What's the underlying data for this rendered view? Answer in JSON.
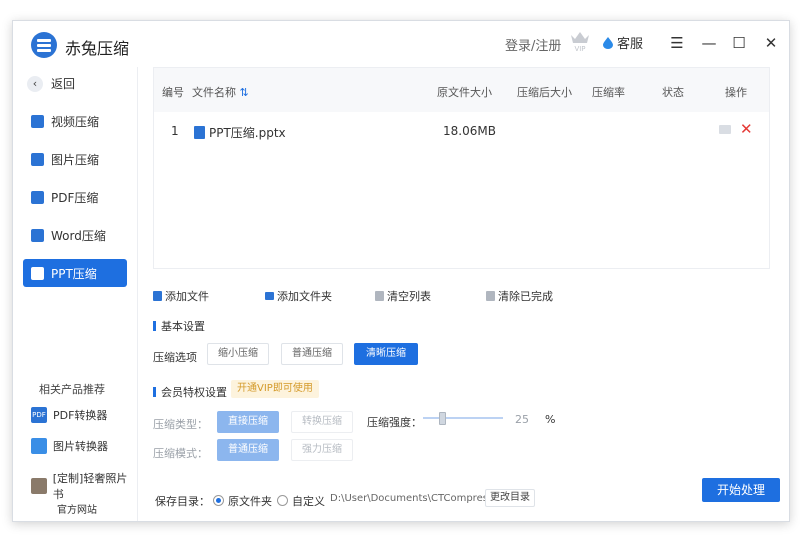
{
  "app": {
    "title": "赤兔压缩",
    "login": "登录/注册",
    "service": "客服",
    "vip_badge": "VIP"
  },
  "window_controls": {
    "menu": "☰",
    "minimize": "—",
    "maximize": "☐",
    "close": "✕"
  },
  "sidebar": {
    "back": "返回",
    "items": [
      {
        "label": "视频压缩",
        "icon": "video-icon"
      },
      {
        "label": "图片压缩",
        "icon": "image-icon"
      },
      {
        "label": "PDF压缩",
        "icon": "pdf-icon"
      },
      {
        "label": "Word压缩",
        "icon": "word-icon"
      },
      {
        "label": "PPT压缩",
        "icon": "ppt-icon",
        "active": true
      }
    ],
    "related_title": "相关产品推荐",
    "related": [
      {
        "label": "PDF转换器",
        "icon_text": "PDF"
      },
      {
        "label": "图片转换器",
        "icon_text": ""
      },
      {
        "label": "[定制]轻奢照片书",
        "icon_text": ""
      }
    ],
    "website": "官方网站"
  },
  "table": {
    "headers": [
      "编号",
      "文件名称",
      "原文件大小",
      "压缩后大小",
      "压缩率",
      "状态",
      "操作"
    ],
    "sort_icon": "⇅",
    "rows": [
      {
        "index": "1",
        "name": "PPT压缩.pptx",
        "size": "18.06MB",
        "compressed": "",
        "ratio": "",
        "status": ""
      }
    ]
  },
  "actions": [
    "添加文件",
    "添加文件夹",
    "清空列表",
    "清除已完成"
  ],
  "basic": {
    "title": "基本设置",
    "option_label": "压缩选项",
    "options": [
      "缩小压缩",
      "普通压缩",
      "清晰压缩"
    ],
    "selected": "清晰压缩"
  },
  "member": {
    "title": "会员特权设置",
    "tag": "开通VIP即可使用",
    "type_label": "压缩类型：",
    "types": [
      "直接压缩",
      "转换压缩"
    ],
    "strength_label": "压缩强度：",
    "strength_value": "25",
    "strength_unit": "%",
    "mode_label": "压缩模式：",
    "modes": [
      "普通压缩",
      "强力压缩"
    ]
  },
  "save": {
    "label": "保存目录：",
    "options": [
      "原文件夹",
      "自定义"
    ],
    "selected": "原文件夹",
    "path": "D:\\User\\Documents\\CTCompres",
    "change_button": "更改目录"
  },
  "start_button": "开始处理",
  "colors": {
    "accent": "#1e6fe0",
    "delete": "#e53935",
    "vip_tag_bg": "#fdf3dd"
  }
}
